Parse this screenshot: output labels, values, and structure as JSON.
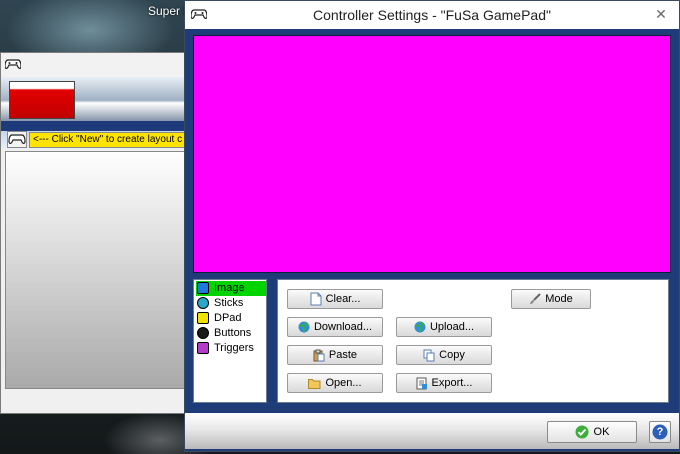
{
  "desktop": {
    "background_title": "Super L"
  },
  "back_window": {
    "hint_text": "<--- Click \"New\" to create layout c",
    "accent_red": "#d90000",
    "hint_color": "#ffe400"
  },
  "dialog": {
    "title": "Controller Settings - \"FuSa GamePad\"",
    "close_glyph": "✕",
    "preview_color": "#ff00ff",
    "frame_color": "#1d3c78"
  },
  "categories": [
    {
      "label": "Image",
      "icon": "image-icon",
      "selected": true
    },
    {
      "label": "Sticks",
      "icon": "stick-icon",
      "selected": false
    },
    {
      "label": "DPad",
      "icon": "dpad-icon",
      "selected": false
    },
    {
      "label": "Buttons",
      "icon": "button-icon",
      "selected": false
    },
    {
      "label": "Triggers",
      "icon": "trigger-icon",
      "selected": false
    }
  ],
  "actions": {
    "clear": "Clear...",
    "mode": "Mode",
    "download": "Download...",
    "upload": "Upload...",
    "paste": "Paste",
    "copy": "Copy",
    "open": "Open...",
    "export": "Export..."
  },
  "footer": {
    "ok_label": "OK",
    "help_glyph": "?"
  }
}
